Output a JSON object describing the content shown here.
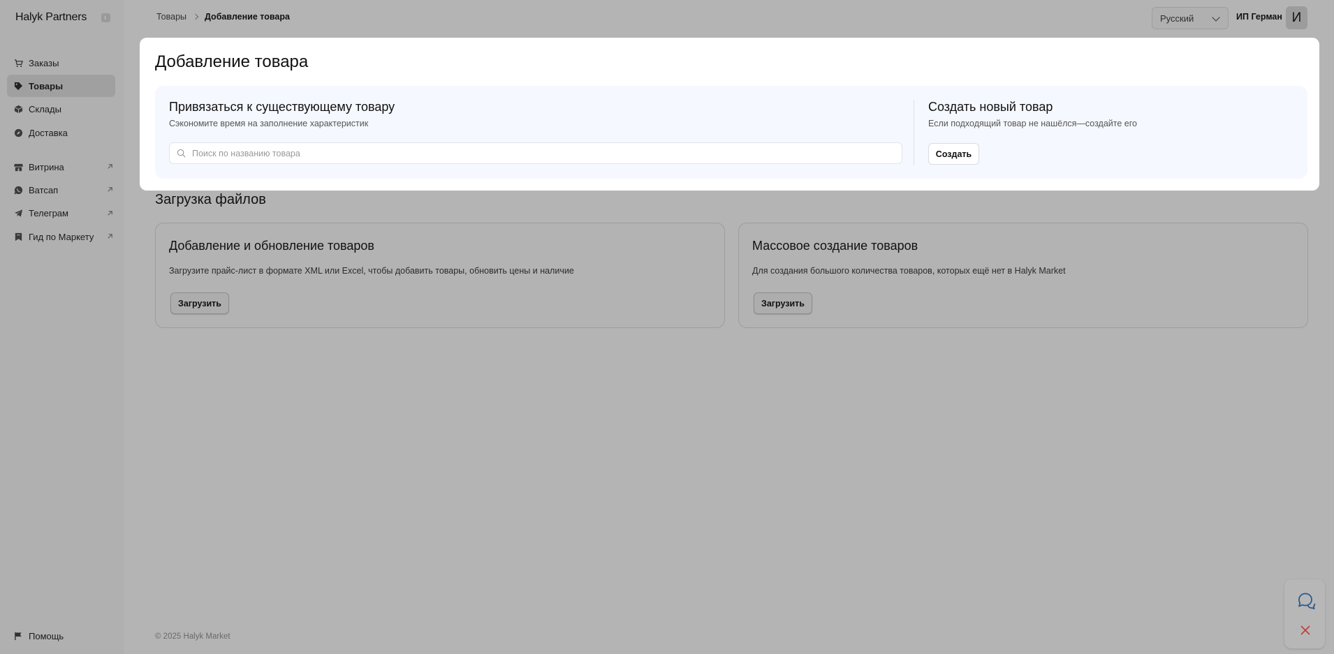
{
  "sidebar": {
    "logo": "Halyk Partners",
    "items": [
      {
        "label": "Заказы",
        "icon": "cart-icon",
        "active": false
      },
      {
        "label": "Товары",
        "icon": "tag-icon",
        "active": true
      },
      {
        "label": "Склады",
        "icon": "box-icon",
        "active": false
      },
      {
        "label": "Доставка",
        "icon": "compass-icon",
        "active": false
      }
    ],
    "external_items": [
      {
        "label": "Витрина",
        "icon": "store-icon"
      },
      {
        "label": "Ватсап",
        "icon": "whatsapp-icon"
      },
      {
        "label": "Телеграм",
        "icon": "telegram-icon"
      },
      {
        "label": "Гид по Маркету",
        "icon": "bookmark-icon"
      }
    ],
    "help_label": "Помощь"
  },
  "header": {
    "breadcrumb": [
      "Товары",
      "Добавление товара"
    ],
    "language": "Русский",
    "user_name": "ИП Герман",
    "avatar_letter": "И"
  },
  "modal": {
    "title": "Добавление товара",
    "link_existing": {
      "title": "Привязаться к существующему товару",
      "subtitle": "Сэкономите время на заполнение характеристик",
      "search_placeholder": "Поиск по названию товара"
    },
    "create_new": {
      "title": "Создать новый товар",
      "subtitle": "Если подходящий товар не нашёлся—создайте его",
      "button": "Создать"
    }
  },
  "files": {
    "title": "Загрузка файлов",
    "cards": [
      {
        "title": "Добавление и обновление товаров",
        "description": "Загрузите прайс-лист в формате XML или Excel, чтобы добавить товары, обновить цены и наличие",
        "button": "Загрузить"
      },
      {
        "title": "Массовое создание товаров",
        "description": "Для создания большого количества товаров, которых ещё нет в Halyk Market",
        "button": "Загрузить"
      }
    ]
  },
  "footer": "© 2025 Halyk Market",
  "colors": {
    "overlay_bg": "#b4b4b4",
    "modal_bg": "#ffffff",
    "modal_inner_bg": "#f5f8fe",
    "widget_close": "#c43a3a",
    "widget_chat": "#2c5a8c"
  }
}
